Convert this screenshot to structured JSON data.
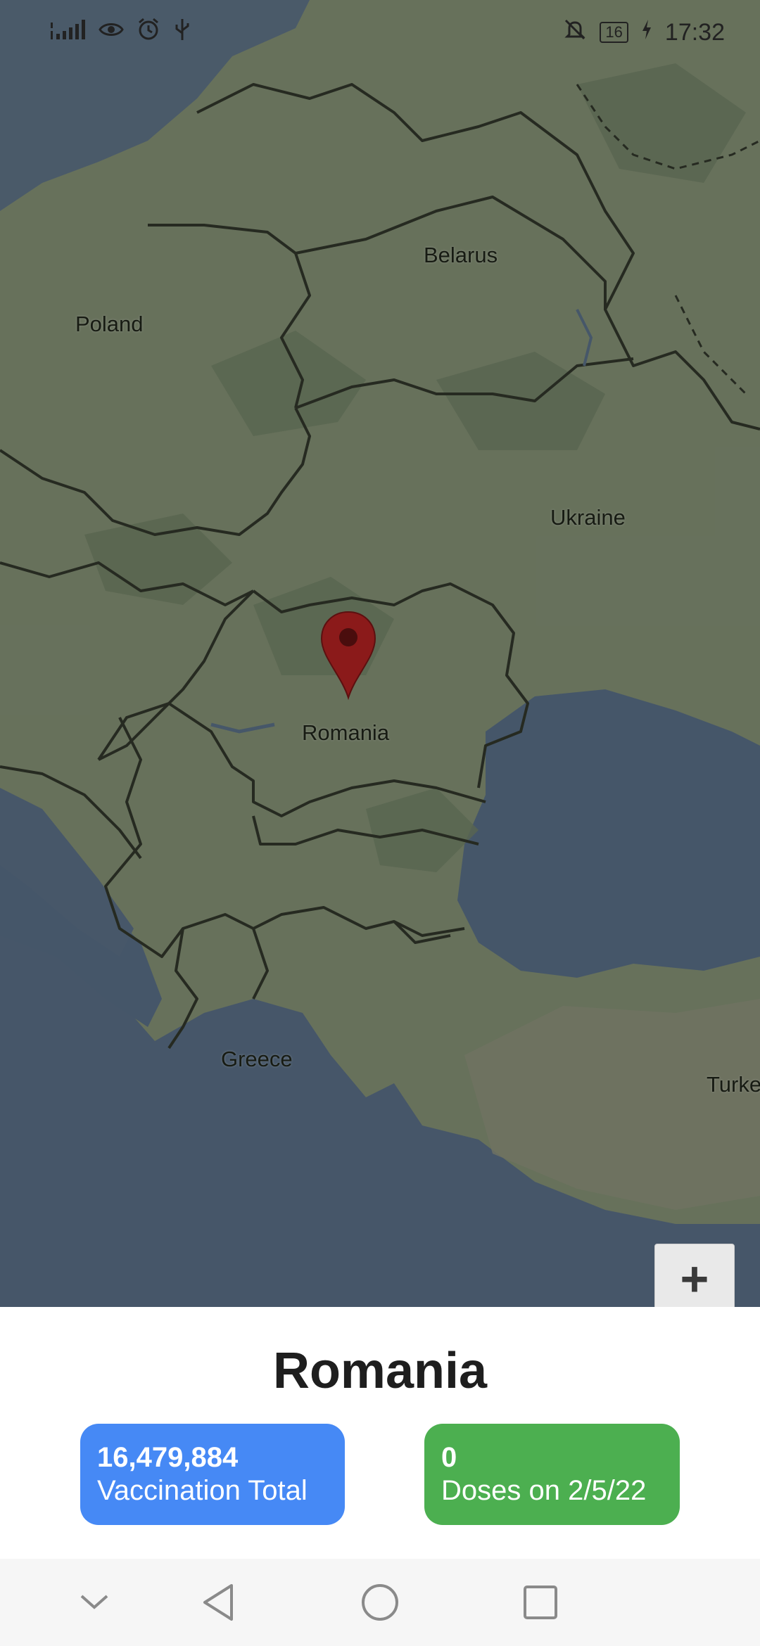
{
  "status_bar": {
    "time": "17:32",
    "battery": "16",
    "left_icons": [
      "signal-icon",
      "eye-icon",
      "alarm-icon",
      "usb-icon"
    ],
    "right_icons": [
      "mute-icon",
      "battery-icon",
      "charging-icon"
    ]
  },
  "map": {
    "labels": {
      "belarus": "Belarus",
      "poland": "Poland",
      "ukraine": "Ukraine",
      "romania": "Romania",
      "greece": "Greece",
      "turkey": "Turke"
    },
    "zoom_in_label": "+",
    "marker_color": "#8b1a1a"
  },
  "sheet": {
    "title": "Romania",
    "total": {
      "value": "16,479,884",
      "label": "Vaccination Total",
      "color": "#4689f5"
    },
    "doses": {
      "value": "0",
      "label": "Doses on 2/5/22",
      "color": "#4caf50"
    }
  },
  "nav": {
    "buttons": [
      "chevron-down-icon",
      "back-icon",
      "home-icon",
      "recents-icon"
    ]
  }
}
